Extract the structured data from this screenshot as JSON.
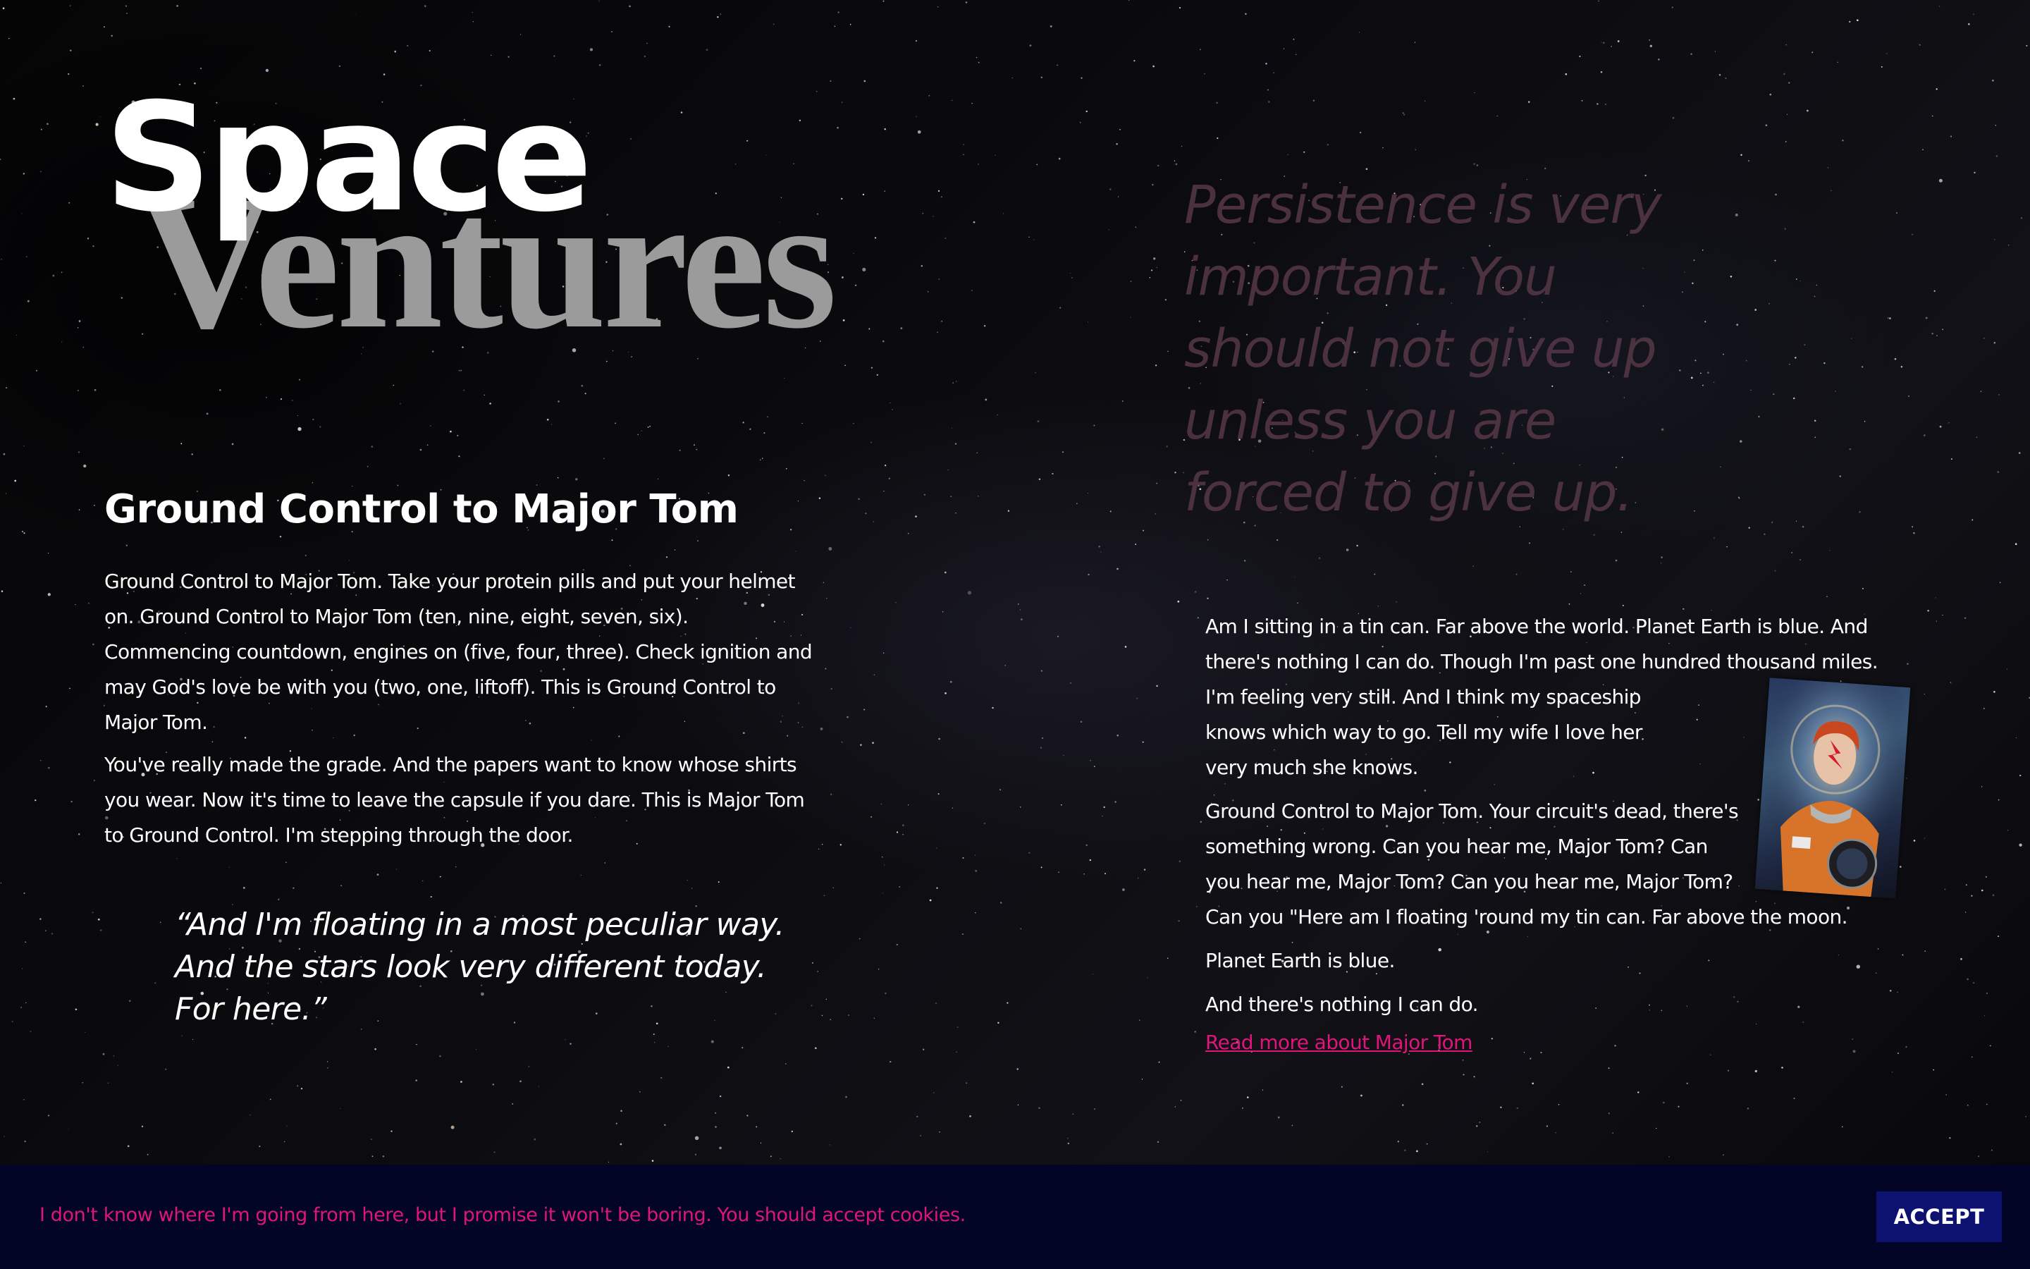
{
  "logo": {
    "line1": "Space",
    "line2": "Ventures"
  },
  "left_section": {
    "title": "Ground Control to Major Tom",
    "paragraphs": [
      "Ground Control to Major Tom. Take your protein pills and put your helmet on. Ground Control to Major Tom (ten, nine, eight, seven, six). Commencing countdown, engines on (five, four, three). Check ignition and may God's love be with you (two, one, liftoff). This is Ground Control to Major Tom.",
      "You've really made the grade. And the papers want to know whose shirts you wear. Now it's time to leave the capsule if you dare. This is Major Tom to Ground Control. I'm stepping through the door."
    ],
    "quote_lines": [
      "“And I'm floating in a most peculiar way.",
      " And the stars look very different today.",
      "For here.”"
    ]
  },
  "persistence_quote": {
    "lines": [
      "Persistence is very",
      "important. You",
      "should not give up",
      "unless you are",
      "forced to give up."
    ]
  },
  "right_section": {
    "para1_lines": [
      "Am I sitting in a tin can. Far above the world. Planet Earth is blue. And",
      "there's nothing I can do.  Though I'm past one hundred thousand miles.",
      "I'm  feeling very still. And I think my spaceship",
      "knows which way to go. Tell my wife I love her",
      "very much she knows."
    ],
    "para2_lines": [
      "Ground Control to Major Tom. Your circuit's dead, there's",
      "something wrong. Can you hear me, Major Tom? Can",
      "you hear me, Major Tom? Can you hear me, Major Tom?",
      "Can you \"Here am I floating 'round my tin can. Far above the moon."
    ],
    "para3": "Planet Earth is blue.",
    "para4": "And there's nothing I can do.",
    "read_more": "Read more about Major Tom",
    "portrait_icon": "astronaut-portrait"
  },
  "cookie_banner": {
    "text": "I don't know where I'm going from here, but I promise it won't be boring. You should accept cookies.",
    "accept_label": "ACCEPT",
    "background": "#020526",
    "text_color": "#e0147a",
    "button_color": "#0d1170"
  },
  "colors": {
    "accent": "#e0147a",
    "logo_grey": "#9b9b9b",
    "persistence": "#5b3a4a"
  }
}
